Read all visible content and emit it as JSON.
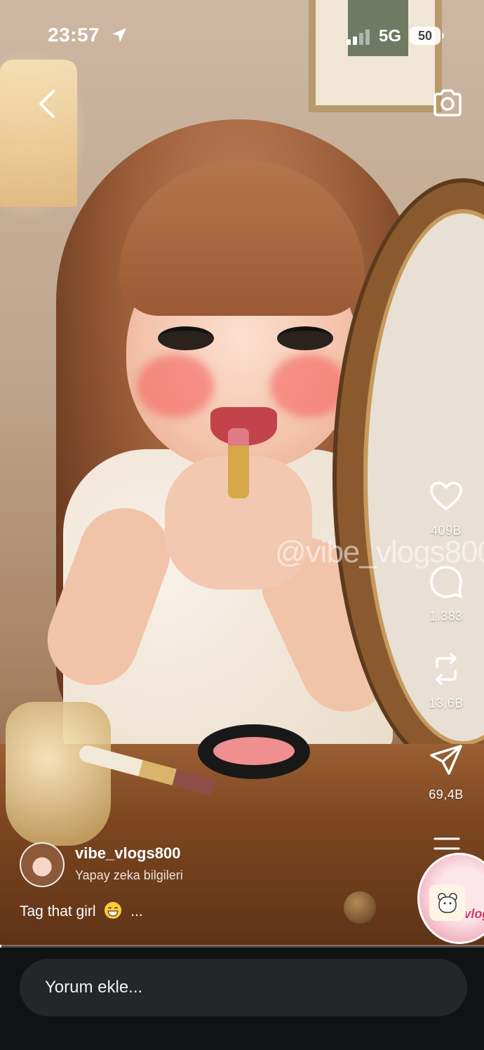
{
  "status_bar": {
    "time": "23:57",
    "network": "5G",
    "battery": "50"
  },
  "top_bar": {
    "back_icon": "chevron-left-icon",
    "camera_icon": "camera-icon"
  },
  "media": {
    "watermark": "@vibe_vlogs800"
  },
  "actions": {
    "like_count": "409B",
    "comment_count": "1.383",
    "repost_count": "13,6B",
    "share_count": "69,4B"
  },
  "author": {
    "username": "vibe_vlogs800",
    "subtitle": "Yapay zeka bilgileri"
  },
  "caption": {
    "text": "Tag that girl",
    "more": "..."
  },
  "audio": {
    "disc_label": "Vibe_vlogs"
  },
  "progress": 0.003,
  "comment_bar": {
    "placeholder": "Yorum ekle..."
  },
  "colors": {
    "bottom_bar": "#111214",
    "input_bg": "#24262a"
  }
}
